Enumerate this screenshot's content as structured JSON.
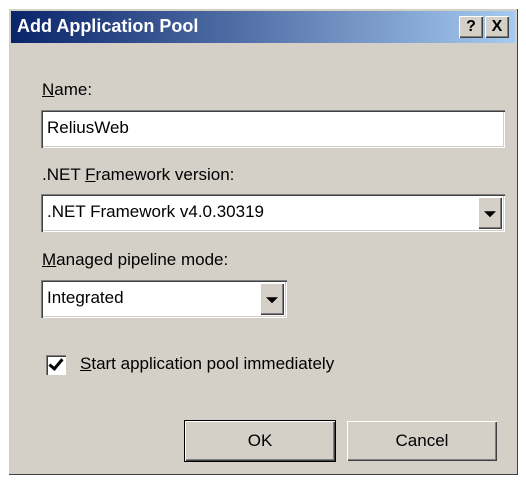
{
  "window": {
    "title": "Add Application Pool",
    "help_label": "?",
    "close_label": "X"
  },
  "name": {
    "label_accel": "N",
    "label_rest": "ame:",
    "value": "ReliusWeb"
  },
  "framework": {
    "label_pre": ".NET ",
    "label_accel": "F",
    "label_rest": "ramework version:",
    "value": ".NET Framework v4.0.30319"
  },
  "pipeline": {
    "label_accel": "M",
    "label_rest": "anaged pipeline mode:",
    "value": "Integrated"
  },
  "start_immediately": {
    "checked": true,
    "label_accel": "S",
    "label_rest": "tart application pool immediately"
  },
  "buttons": {
    "ok": "OK",
    "cancel": "Cancel"
  }
}
